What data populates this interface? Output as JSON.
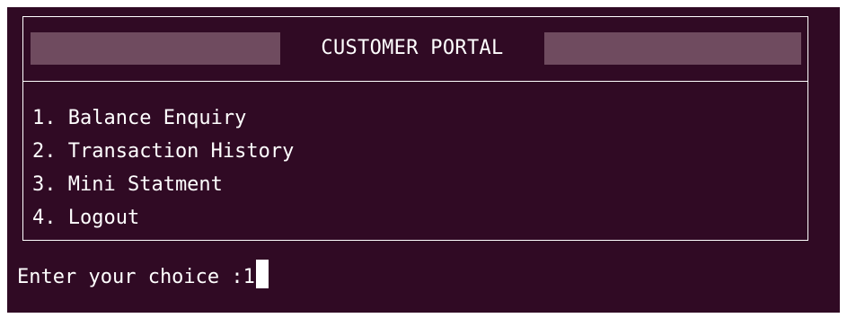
{
  "portal": {
    "title": "CUSTOMER PORTAL",
    "menu_items": [
      "1. Balance Enquiry",
      "2. Transaction History",
      "3. Mini Statment",
      "4. Logout"
    ]
  },
  "prompt": {
    "text": "Enter your choice :",
    "input_value": "1"
  },
  "colors": {
    "terminal_background": "#300a24",
    "header_bar": "#6f4b5f",
    "text": "#ffffff"
  }
}
